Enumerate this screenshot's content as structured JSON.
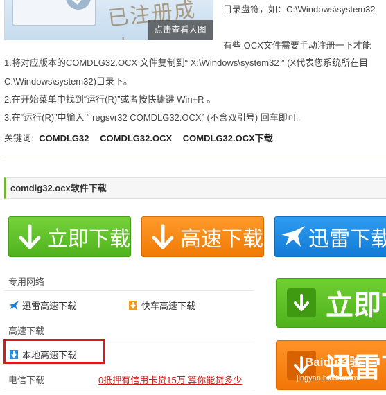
{
  "thumbnail": {
    "deco_text": "已注册成功",
    "caption": "点击查看大图"
  },
  "side_text": {
    "line1": "目录盘符，如：C:\\Windows\\system32",
    "line2": "有些 OCX文件需要手动注册一下才能"
  },
  "steps": [
    "1.将对应版本的COMDLG32.OCX 文件复制到“ X:\\Windows\\system32 ” (X代表您系统所在目",
    "C:\\Windows\\system32)目录下。",
    "2.在开始菜单中找到“运行(R)”或者按快捷键 Win+R 。",
    "3.在“运行(R)”中输入 “ regsvr32 COMDLG32.OCX” (不含双引号) 回车即可。"
  ],
  "keywords": {
    "label": "关键词:",
    "items": [
      "COMDLG32",
      "COMDLG32.OCX",
      "COMDLG32.OCX下载"
    ]
  },
  "download_section": {
    "title": "comdlg32.ocx软件下载",
    "buttons": [
      {
        "label": "立即下载",
        "icon": "down-arrow-icon",
        "color": "#5cc128"
      },
      {
        "label": "高速下载",
        "icon": "down-arrow-icon",
        "color": "#f7870f"
      },
      {
        "label": "迅雷下载",
        "icon": "thunder-bird-icon",
        "color": "#1a8ae3"
      }
    ],
    "rows": {
      "dedicated_label": "专用网络",
      "thunder_link": "迅雷高速下载",
      "kuaiche_link": "快车高速下载",
      "highspeed_label": "高速下载",
      "local_link": "本地高速下载",
      "telecom_label": "电信下载",
      "ad_text": "0抵押有信用卡贷15万 算你能贷多少"
    },
    "side_buttons": [
      {
        "label": "立即下",
        "color": "#5cbf25"
      },
      {
        "label": "迅雷下",
        "color": "#f47b0c"
      }
    ]
  },
  "watermark": {
    "brand": "Baidu经验",
    "url": "jingyan.baidu.com"
  }
}
